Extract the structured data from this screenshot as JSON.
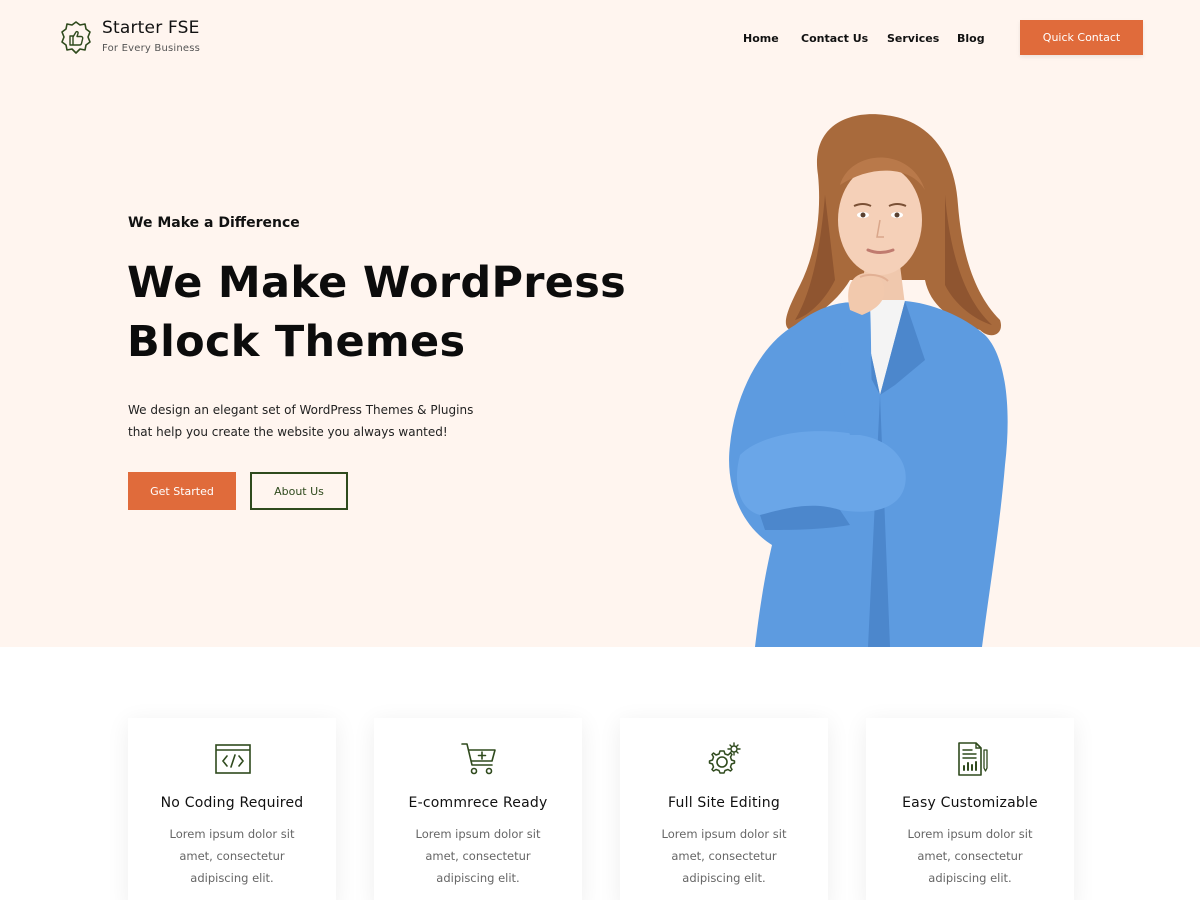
{
  "brand": {
    "title": "Starter FSE",
    "tagline": "For Every Business",
    "logo_icon": "thumbs-up-badge-icon"
  },
  "nav": {
    "items": [
      "Home",
      "Contact Us",
      "Services",
      "Blog"
    ],
    "cta_label": "Quick Contact"
  },
  "hero": {
    "eyebrow": "We Make a Difference",
    "headline_line1": "We Make WordPress",
    "headline_line2": "Block Themes",
    "desc_line1": "We design an elegant set of WordPress Themes & Plugins",
    "desc_line2": "that help you create the website you always wanted!",
    "primary_button": "Get Started",
    "secondary_button": "About Us"
  },
  "features": [
    {
      "icon": "code-window-icon",
      "title": "No Coding Required",
      "lines": [
        "Lorem ipsum dolor sit",
        "amet, consectetur",
        "adipiscing elit."
      ]
    },
    {
      "icon": "shopping-cart-icon",
      "title": "E-commrece Ready",
      "lines": [
        "Lorem ipsum dolor sit",
        "amet, consectetur",
        "adipiscing elit."
      ]
    },
    {
      "icon": "gears-icon",
      "title": "Full Site Editing",
      "lines": [
        "Lorem ipsum dolor sit",
        "amet, consectetur",
        "adipiscing elit."
      ]
    },
    {
      "icon": "document-chart-icon",
      "title": "Easy Customizable",
      "lines": [
        "Lorem ipsum dolor sit",
        "amet, consectetur",
        "adipiscing elit."
      ]
    }
  ],
  "colors": {
    "accent": "#e06b3b",
    "hero_bg": "#fff5ef",
    "icon_green": "#2f4a1d"
  }
}
